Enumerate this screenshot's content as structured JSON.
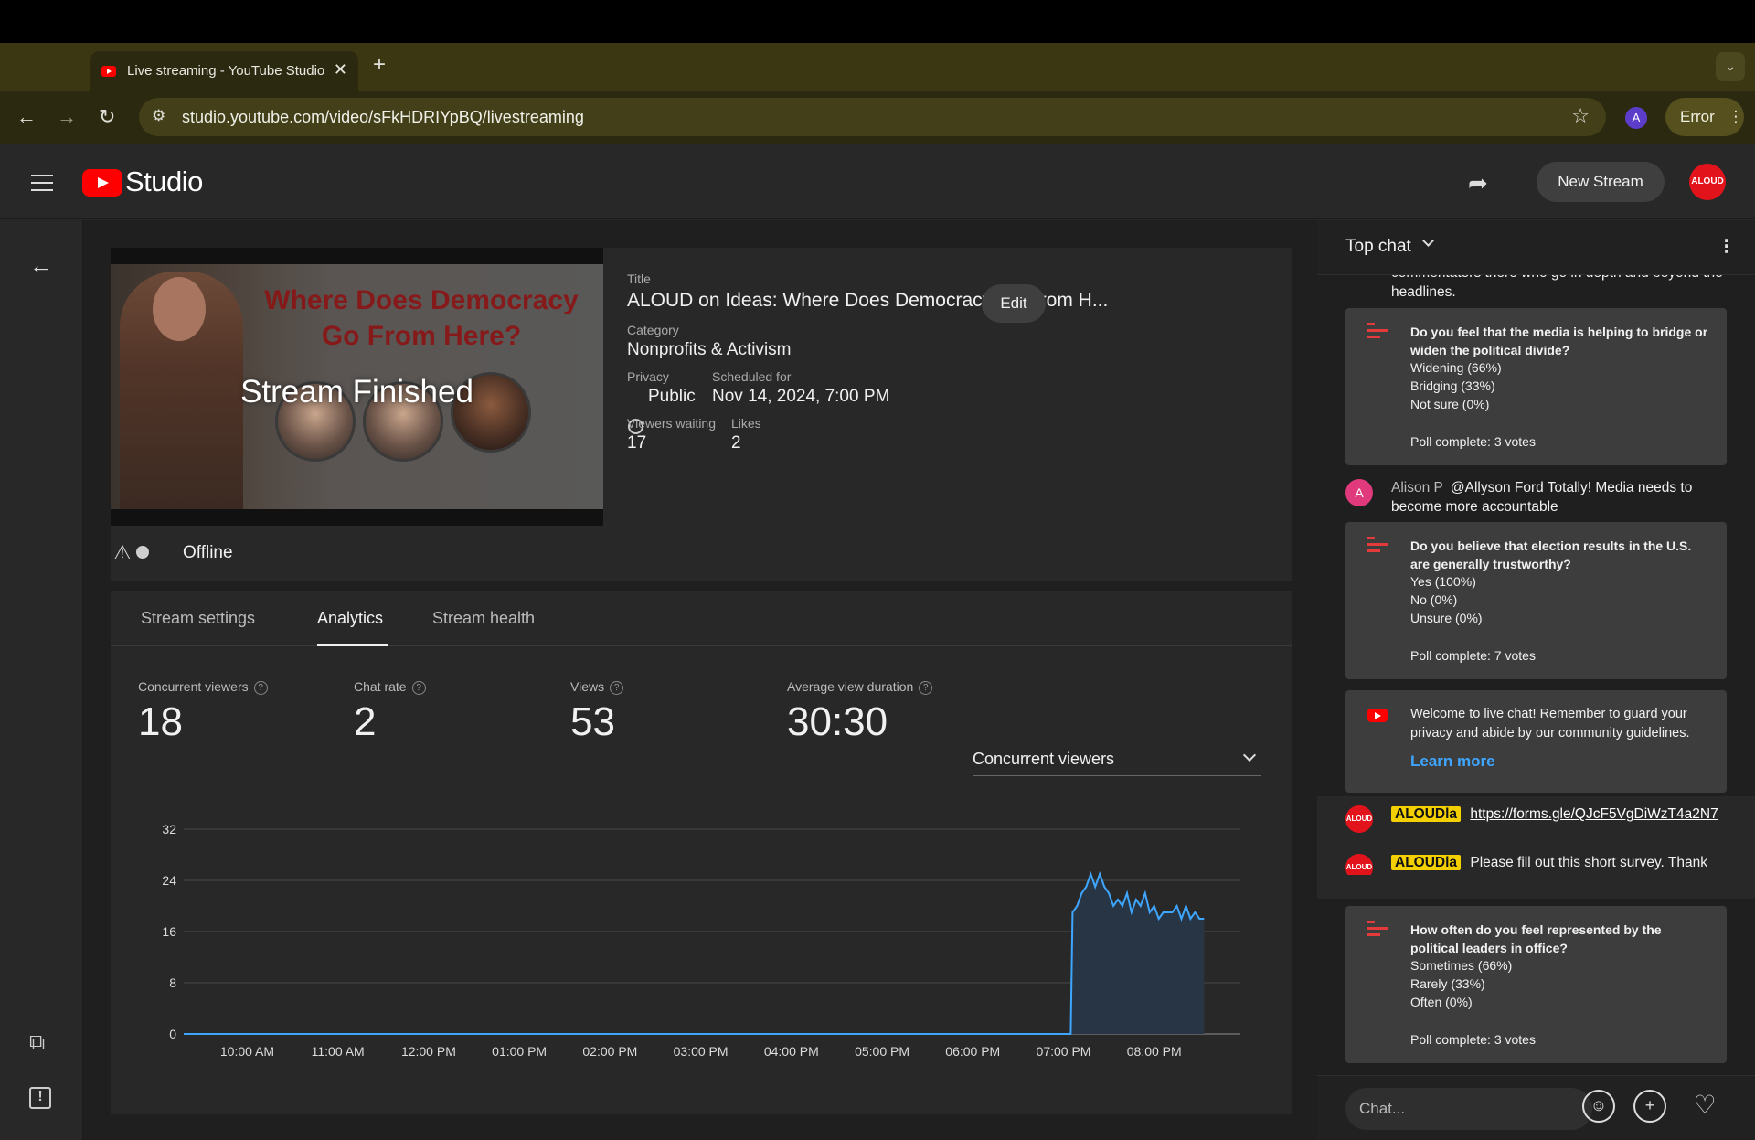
{
  "browser": {
    "tab_title": "Live streaming - YouTube Studio",
    "tab_close": "✕",
    "new_tab": "+",
    "url": "studio.youtube.com/video/sFkHDRIYpBQ/livestreaming",
    "profile_initial": "A",
    "error_label": "Error",
    "error_menu": "⋮"
  },
  "header": {
    "logo_text": "Studio",
    "new_stream_label": "New Stream",
    "avatar_text": "ALOUD",
    "accent_color": "#ff0000"
  },
  "stream": {
    "thumbnail_headline": "Where Does Democracy Go From Here?",
    "thumbnail_overlay": "Stream Finished",
    "title_label": "Title",
    "title": "ALOUD on Ideas: Where Does Democracy Go From H...",
    "edit_label": "Edit",
    "category_label": "Category",
    "category": "Nonprofits & Activism",
    "privacy_label": "Privacy",
    "privacy": "Public",
    "scheduled_label": "Scheduled for",
    "scheduled": "Nov 14, 2024, 7:00 PM",
    "viewers_waiting_label": "Viewers waiting",
    "viewers_waiting": "17",
    "likes_label": "Likes",
    "likes": "2",
    "status": "Offline"
  },
  "tabs": [
    {
      "label": "Stream settings",
      "active": false
    },
    {
      "label": "Analytics",
      "active": true
    },
    {
      "label": "Stream health",
      "active": false
    }
  ],
  "metrics": [
    {
      "label": "Concurrent viewers",
      "value": "18"
    },
    {
      "label": "Chat rate",
      "value": "2"
    },
    {
      "label": "Views",
      "value": "53"
    },
    {
      "label": "Average view duration",
      "value": "30:30"
    }
  ],
  "metric_select": "Concurrent viewers",
  "chart_data": {
    "type": "area",
    "title": "",
    "xlabel": "",
    "ylabel": "",
    "ylim": [
      0,
      32
    ],
    "yticks": [
      0,
      8,
      16,
      24,
      32
    ],
    "xticks": [
      "10:00 AM",
      "11:00 AM",
      "12:00 PM",
      "01:00 PM",
      "02:00 PM",
      "03:00 PM",
      "04:00 PM",
      "05:00 PM",
      "06:00 PM",
      "07:00 PM",
      "08:00 PM"
    ],
    "grid": true,
    "color": "#3ea6ff",
    "fill": "#273545",
    "series": [
      {
        "x_hours": [
          9.3,
          10,
          11,
          12,
          13,
          14,
          15,
          16,
          17,
          18,
          19.0,
          19.08,
          19.1,
          19.15,
          19.2,
          19.25,
          19.3,
          19.35,
          19.4,
          19.45,
          19.5,
          19.55,
          19.6,
          19.65,
          19.7,
          19.75,
          19.8,
          19.85,
          19.9,
          19.95,
          20.0,
          20.05,
          20.1,
          20.15,
          20.2,
          20.25,
          20.3,
          20.35,
          20.4,
          20.45,
          20.5,
          20.55
        ],
        "values": [
          0,
          0,
          0,
          0,
          0,
          0,
          0,
          0,
          0,
          0,
          0,
          0,
          19,
          20,
          22,
          23,
          25,
          23,
          25,
          23,
          22,
          20,
          21,
          20,
          22,
          19,
          21,
          20,
          22,
          19,
          20,
          18,
          19,
          19,
          19,
          20,
          18,
          20,
          18,
          19,
          18,
          18
        ]
      }
    ]
  },
  "chat": {
    "header": "Top chat",
    "menu": "⋮",
    "partial_message": "commentators there who go in depth and beyond the headlines.",
    "items": [
      {
        "type": "poll",
        "question": "Do you feel that the media is helping to bridge or widen the political divide?",
        "options": [
          "Widening (66%)",
          "Bridging (33%)",
          "Not sure (0%)"
        ],
        "footer": "Poll complete: 3 votes"
      },
      {
        "type": "message",
        "avatar": "A",
        "author": "Alison P",
        "text": "@Allyson Ford Totally! Media needs to become more accountable"
      },
      {
        "type": "poll",
        "question": "Do you believe that election results in the U.S. are generally trustworthy?",
        "options": [
          "Yes (100%)",
          "No (0%)",
          "Unsure (0%)"
        ],
        "footer": "Poll complete: 7 votes"
      },
      {
        "type": "notice",
        "text": "Welcome to live chat! Remember to guard your privacy and abide by our community guidelines.",
        "link": "Learn more"
      },
      {
        "type": "owner",
        "avatar": "ALOUD",
        "author": "ALOUDla",
        "text": "https://forms.gle/QJcF5VgDiWzT4a2N7"
      },
      {
        "type": "owner",
        "avatar": "ALOUD",
        "author": "ALOUDla",
        "text": "Please fill out this short survey. Thank you!"
      },
      {
        "type": "poll",
        "question": "How often do you feel represented by the political leaders in office?",
        "options": [
          "Sometimes (66%)",
          "Rarely (33%)",
          "Often (0%)"
        ],
        "footer": "Poll complete: 3 votes"
      }
    ],
    "input_placeholder": "Chat..."
  }
}
